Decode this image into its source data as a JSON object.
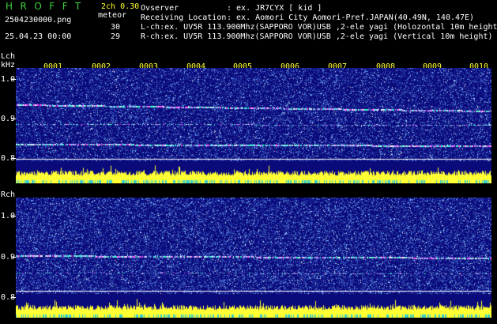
{
  "header": {
    "app_title": "HROFFT",
    "version": "2ch 0.30",
    "mode": "meteor",
    "filename": "2504230000.png",
    "datetime": "25.04.23 00:00",
    "lch_count": "30",
    "rch_count": "29",
    "observer_label": "Ovserver",
    "observer_value": ": ex. JR7CYX [ kid ]",
    "location_label": "Receiving Location",
    "location_value": ": ex. Aomori City Aomori-Pref.JAPAN(40.49N, 140.47E)",
    "lch_info": "L-ch:ex. UV5R 113.900Mhz(SAPPORO VOR)USB ,2-ele yagi (Holozontal 10m height)",
    "rch_info": "R-ch:ex. UV5R 113.900Mhz(SAPPORO VOR)USB ,2-ele yagi (Vertical 10m height)"
  },
  "minutes": [
    "0001",
    "0002",
    "0003",
    "0004",
    "0005",
    "0006",
    "0007",
    "0008",
    "0009",
    "0010"
  ],
  "lch": {
    "label": "Lch",
    "unit": "kHz",
    "yticks": [
      "1.0",
      "0.9",
      "0.8"
    ]
  },
  "rch": {
    "label": "Rch",
    "yticks": [
      "1.0",
      "0.9",
      "0.8"
    ]
  },
  "colors": {
    "title_green": "#3ccf3c",
    "spectrum_bg": "#0a0a7a",
    "signal_yellow": "#ffff33",
    "activity_cyan": "#33cccc",
    "text": "#ffffff"
  }
}
